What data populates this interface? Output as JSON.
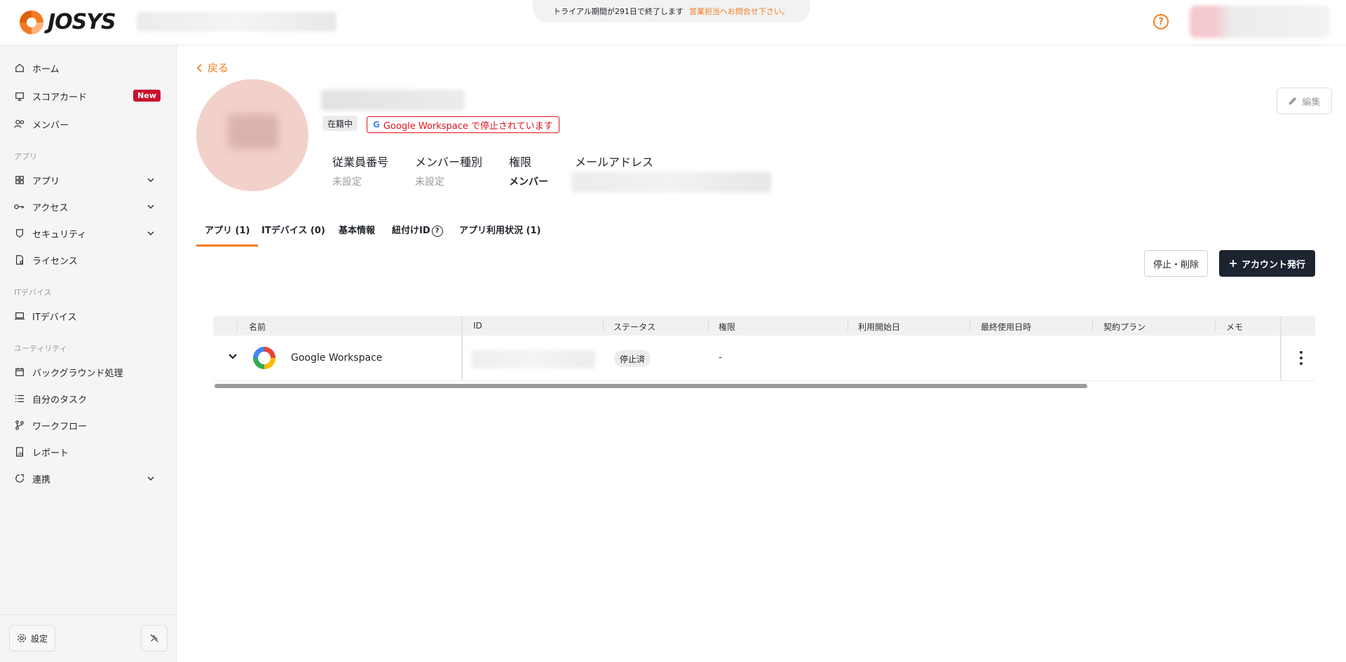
{
  "header": {
    "logo_text": "JOSYS",
    "trial_notice": "トライアル期間が291日で終了します",
    "trial_link": "営業担当へお問合せ下さい。",
    "help_symbol": "?"
  },
  "sidebar": {
    "items": [
      {
        "label": "ホーム",
        "icon": "home-icon"
      },
      {
        "label": "スコアカード",
        "icon": "scorecard-icon",
        "badge": "New"
      },
      {
        "label": "メンバー",
        "icon": "members-icon"
      }
    ],
    "section_app": "アプリ",
    "app_items": [
      {
        "label": "アプリ",
        "icon": "grid-icon"
      },
      {
        "label": "アクセス",
        "icon": "key-icon"
      },
      {
        "label": "セキュリティ",
        "icon": "shield-icon"
      },
      {
        "label": "ライセンス",
        "icon": "license-icon"
      }
    ],
    "section_device": "ITデバイス",
    "device_items": [
      {
        "label": "ITデバイス",
        "icon": "laptop-icon"
      }
    ],
    "section_utility": "ユーティリティ",
    "utility_items": [
      {
        "label": "バックグラウンド処理",
        "icon": "calendar-icon"
      },
      {
        "label": "自分のタスク",
        "icon": "tasks-icon"
      },
      {
        "label": "ワークフロー",
        "icon": "workflow-icon"
      },
      {
        "label": "レポート",
        "icon": "report-icon"
      },
      {
        "label": "連携",
        "icon": "integration-icon"
      }
    ],
    "settings_label": "設定"
  },
  "profile": {
    "back_label": "戻る",
    "status": "在籍中",
    "warning": "Google Workspace で停止されています",
    "edit_label": "編集",
    "fields": [
      {
        "label": "従業員番号",
        "value": "未設定"
      },
      {
        "label": "メンバー種別",
        "value": "未設定"
      },
      {
        "label": "権限",
        "value": "メンバー"
      },
      {
        "label": "メールアドレス",
        "value": ""
      }
    ]
  },
  "tabs": [
    {
      "label": "アプリ (1)",
      "active": true
    },
    {
      "label": "ITデバイス (0)",
      "active": false
    },
    {
      "label": "基本情報",
      "active": false
    },
    {
      "label": "紐付けID",
      "active": false
    },
    {
      "label": "アプリ利用状況 (1)",
      "active": false
    }
  ],
  "actions": {
    "stop_delete": "停止・削除",
    "issue_account": "アカウント発行"
  },
  "table": {
    "columns": [
      "名前",
      "ID",
      "ステータス",
      "権限",
      "利用開始日",
      "最終使用日時",
      "契約プラン",
      "メモ"
    ],
    "rows": [
      {
        "name": "Google Workspace",
        "status": "停止済",
        "permission": "-"
      }
    ]
  }
}
